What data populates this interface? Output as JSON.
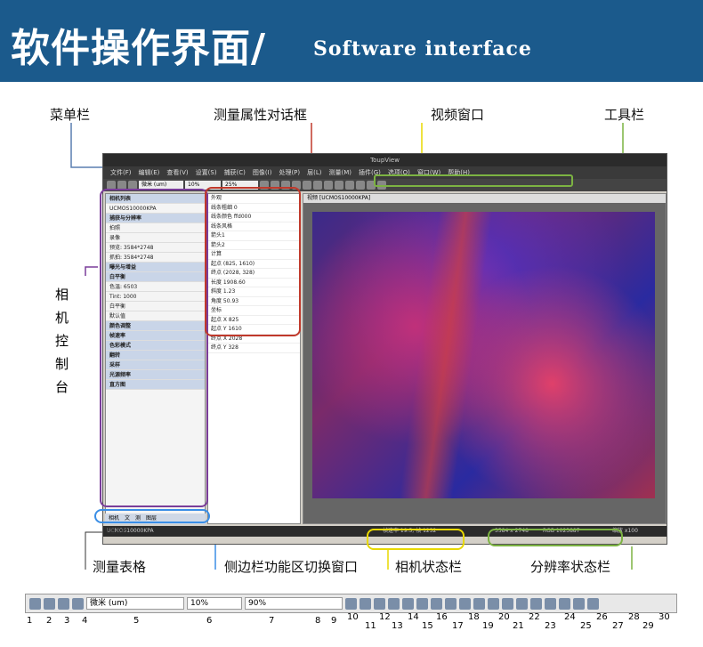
{
  "banner": {
    "title_cn": "软件操作界面/",
    "title_en": "Software interface"
  },
  "annotations": {
    "menubar": "菜单栏",
    "measure_dialog": "测量属性对话框",
    "video_window": "视频窗口",
    "toolbar": "工具栏",
    "camera_console": [
      "相",
      "机",
      "控",
      "制",
      "台"
    ],
    "measure_table": "测量表格",
    "sidebar_switch": "侧边栏功能区切换窗口",
    "camera_status": "相机状态栏",
    "resolution_status": "分辨率状态栏"
  },
  "app": {
    "title": "ToupView",
    "menu": [
      "文件(F)",
      "编辑(E)",
      "查看(V)",
      "设置(S)",
      "捕获(C)",
      "图像(I)",
      "处理(P)",
      "层(L)",
      "测量(M)",
      "插件(G)",
      "选项(O)",
      "窗口(W)",
      "帮助(H)"
    ],
    "toolbar_fields": {
      "unit": "微米 (um)",
      "zoom": "10%",
      "ratio": "25%"
    },
    "sidebar": [
      "相机列表",
      "UCMOS10000KPA",
      "捕获与分辨率",
      "拍照",
      "录像",
      "预览: 3584*2748",
      "抓拍: 3584*2748",
      "曝光与增益",
      "白平衡",
      "色温: 6503",
      "Tint: 1000",
      "白平衡",
      "默认值",
      "颜色调整",
      "帧速率",
      "色彩模式",
      "翻转",
      "采样",
      "光源频率",
      "直方图"
    ],
    "side_tabs": [
      "相机",
      "文",
      "测",
      "图层"
    ],
    "props": [
      "外观",
      "线条粗细 0",
      "线条颜色 ffd000",
      "线条风格",
      "箭头1",
      "箭头2",
      "计算",
      "起点 (825, 1610)",
      "终点 (2028, 328)",
      "长度 1908.60",
      "斜度 1.23",
      "角度 50.93",
      "坐标",
      "起点 X 825",
      "起点 Y 1610",
      "终点 X 2028",
      "终点 Y 328"
    ],
    "video_tab": "视频 [UCMOS10000KPA]",
    "measure_tab": "测量表格",
    "status": {
      "camera": "UCMOS10000KPA",
      "rate": "帧速率 19.5; 帧 1232",
      "res": "3584 x 2748",
      "colour": "RGB 1023887",
      "zoom": "缩放 x100"
    }
  },
  "toolbar_strip": {
    "unit": "微米 (um)",
    "zoom": "10%",
    "ratio": "90%",
    "numbers": [
      "1",
      "2",
      "3",
      "4",
      "5",
      "6",
      "7",
      "8",
      "9",
      "10",
      "11",
      "12",
      "13",
      "14",
      "15",
      "16",
      "17",
      "18",
      "19",
      "20",
      "21",
      "22",
      "23",
      "24",
      "25",
      "26",
      "27",
      "28",
      "29",
      "30"
    ]
  },
  "colors": {
    "banner": "#1b5a8c",
    "purple": "#7a3d9a",
    "red": "#c0392b",
    "yellow": "#e8d800",
    "green": "#7cb342",
    "blue": "#3a8ee6"
  }
}
